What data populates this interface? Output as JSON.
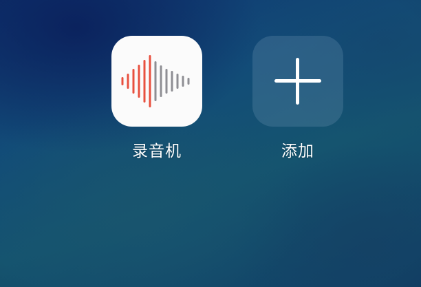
{
  "apps": [
    {
      "label": "录音机",
      "icon": "voice-recorder-icon",
      "wave_colors": {
        "left": "#e8503f",
        "right": "#8e8e93"
      }
    },
    {
      "label": "添加",
      "icon": "plus-icon"
    }
  ]
}
